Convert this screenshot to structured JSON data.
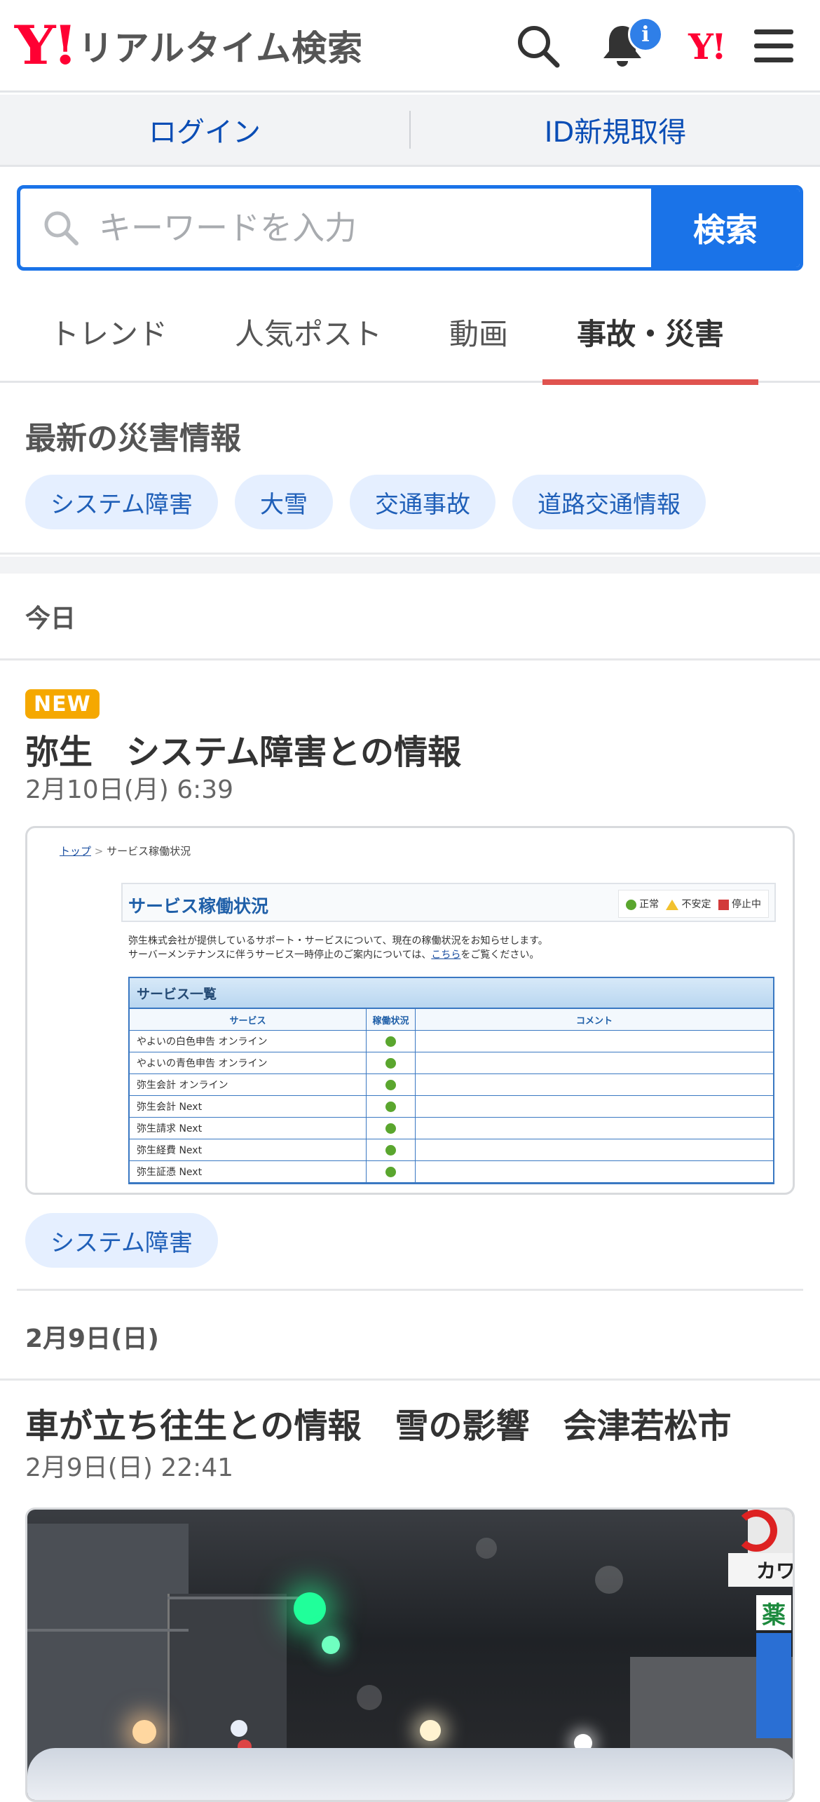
{
  "header": {
    "logo_mark": "Y!",
    "logo_text": "リアルタイム検索",
    "notification_badge": "i",
    "yj_mark": "Y!"
  },
  "account": {
    "login": "ログイン",
    "register": "ID新規取得"
  },
  "search": {
    "placeholder": "キーワードを入力",
    "button": "検索"
  },
  "tabs": [
    {
      "label": "トレンド"
    },
    {
      "label": "人気ポスト"
    },
    {
      "label": "動画"
    },
    {
      "label": "事故・災害",
      "active": true
    }
  ],
  "disaster": {
    "title": "最新の災害情報",
    "chips": [
      "システム障害",
      "大雪",
      "交通事故",
      "道路交通情報"
    ]
  },
  "feed": [
    {
      "date_header": "今日",
      "badge": "NEW",
      "title": "弥生　システム障害との情報",
      "datetime": "2月10日(月) 6:39",
      "tag": "システム障害",
      "thumbnail": {
        "breadcrumb_link": "トップ",
        "breadcrumb_sep": ">",
        "breadcrumb_current": "サービス稼働状況",
        "heading": "サービス稼働状況",
        "legend": [
          "正常",
          "不安定",
          "停止中"
        ],
        "intro_line1": "弥生株式会社が提供しているサポート・サービスについて、現在の稼働状況をお知らせします。",
        "intro_line2_pre": "サーバーメンテナンスに伴うサービス一時停止のご案内については、",
        "intro_line2_link": "こちら",
        "intro_line2_post": "をご覧ください。",
        "table_title": "サービス一覧",
        "columns": [
          "サービス",
          "稼働状況",
          "コメント"
        ],
        "rows": [
          {
            "service": "やよいの白色申告 オンライン",
            "status": "正常"
          },
          {
            "service": "やよいの青色申告 オンライン",
            "status": "正常"
          },
          {
            "service": "弥生会計 オンライン",
            "status": "正常"
          },
          {
            "service": "弥生会計 Next",
            "status": "正常"
          },
          {
            "service": "弥生請求 Next",
            "status": "正常"
          },
          {
            "service": "弥生経費 Next",
            "status": "正常"
          },
          {
            "service": "弥生証憑 Next",
            "status": "正常"
          }
        ]
      }
    },
    {
      "date_header": "2月9日(日)",
      "title": "車が立ち往生との情報　雪の影響　会津若松市",
      "datetime": "2月9日(日) 22:41",
      "thumbnail": {
        "sign_text": "カワ",
        "sign_text2": "薬"
      }
    }
  ],
  "colors": {
    "brand_red": "#ff0033",
    "primary_blue": "#1a73e8",
    "active_tab_underline": "#e0534f",
    "chip_bg": "#e5efff",
    "new_badge": "#f5a800"
  }
}
